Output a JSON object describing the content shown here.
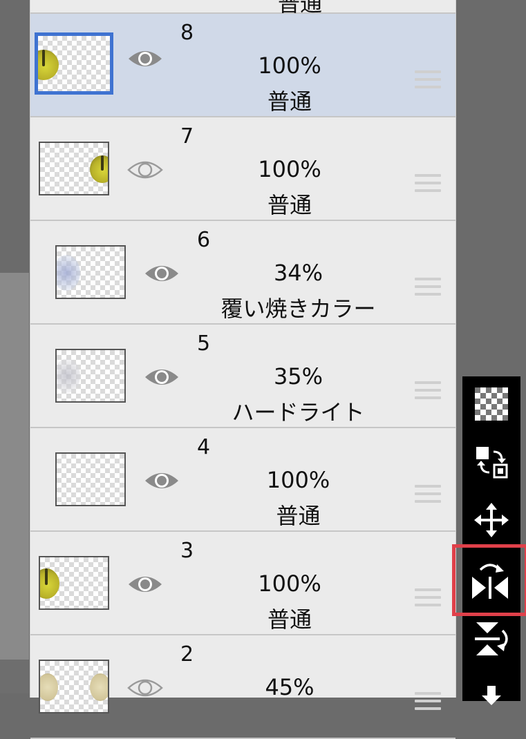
{
  "layers": [
    {
      "number": "",
      "opacity": "",
      "mode": "普通",
      "partial_top": true
    },
    {
      "number": "8",
      "opacity": "100%",
      "mode": "普通",
      "selected": true,
      "visible": true,
      "clipped": false
    },
    {
      "number": "7",
      "opacity": "100%",
      "mode": "普通",
      "selected": false,
      "visible": true,
      "clipped": false
    },
    {
      "number": "6",
      "opacity": "34%",
      "mode": "覆い焼きカラー",
      "selected": false,
      "visible": true,
      "clipped": true
    },
    {
      "number": "5",
      "opacity": "35%",
      "mode": "ハードライト",
      "selected": false,
      "visible": true,
      "clipped": true
    },
    {
      "number": "4",
      "opacity": "100%",
      "mode": "普通",
      "selected": false,
      "visible": true,
      "clipped": true
    },
    {
      "number": "3",
      "opacity": "100%",
      "mode": "普通",
      "selected": false,
      "visible": true,
      "clipped": false
    },
    {
      "number": "2",
      "opacity": "45%",
      "mode": "",
      "selected": false,
      "visible": true,
      "clipped": false
    }
  ],
  "toolbar": {
    "tools": [
      {
        "icon": "transparency-grid-icon"
      },
      {
        "icon": "swap-layers-icon"
      },
      {
        "icon": "move-icon"
      },
      {
        "icon": "flip-horizontal-icon",
        "highlighted": true,
        "highlight_color": "#e0404a"
      },
      {
        "icon": "flip-vertical-icon"
      },
      {
        "icon": "merge-down-icon"
      }
    ]
  },
  "colors": {
    "selected_row": "#d0d9e8",
    "selected_border": "#3f73d1",
    "panel_bg": "#ebebeb",
    "toolbar_bg": "#000000"
  }
}
